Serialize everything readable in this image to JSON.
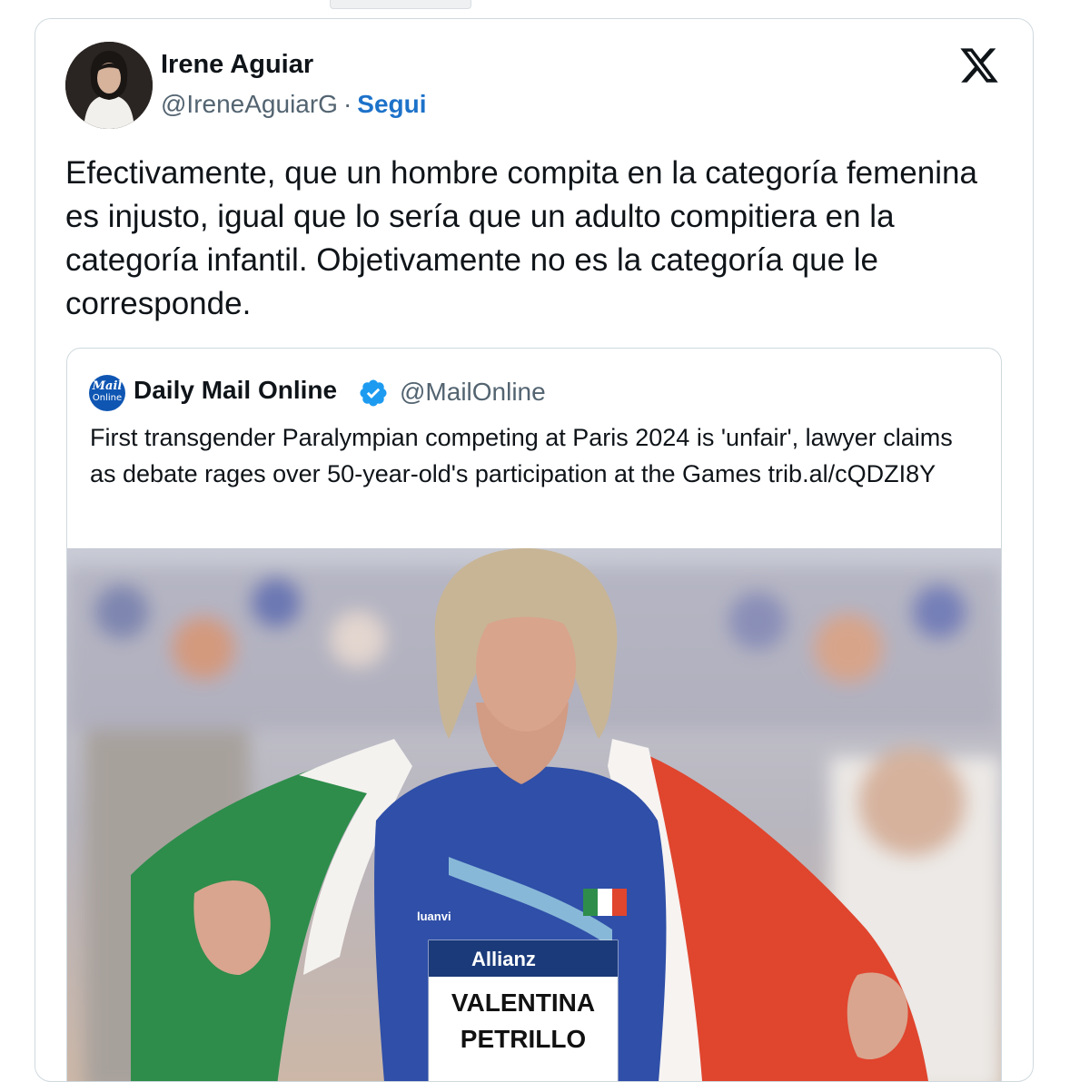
{
  "tweet": {
    "author_name": "Irene Aguiar",
    "author_handle": "@IreneAguiarG",
    "separator": "·",
    "follow_label": "Segui",
    "text": "Efectivamente, que un hombre compita en la categoría femenina es injusto, igual que lo sería que un adulto compitiera en la categoría infantil. Objetivamente no es la categoría que le corresponde.",
    "platform_icon": "x-logo-icon"
  },
  "quoted_tweet": {
    "avatar_logo": {
      "line1": "Mail",
      "line2": "Online"
    },
    "author_name": "Daily Mail Online",
    "verified_icon": "verified-badge-icon",
    "author_handle": "@MailOnline",
    "text": "First transgender Paralympian competing at Paris 2024 is 'unfair', lawyer claims as debate rages over 50-year-old's participation at the Games trib.al/cQDZI8Y",
    "image": {
      "description": "Athlete in blue Italy kit holding Italian flag",
      "bib_sponsor": "Allianz",
      "bib_line1": "VALENTINA",
      "bib_line2": "PETRILLO",
      "kit_logo": "luanvi"
    }
  },
  "colors": {
    "follow": "#1d72c9",
    "verified": "#1d9bf0",
    "border": "#cfd9de",
    "secondary_text": "#536471"
  }
}
